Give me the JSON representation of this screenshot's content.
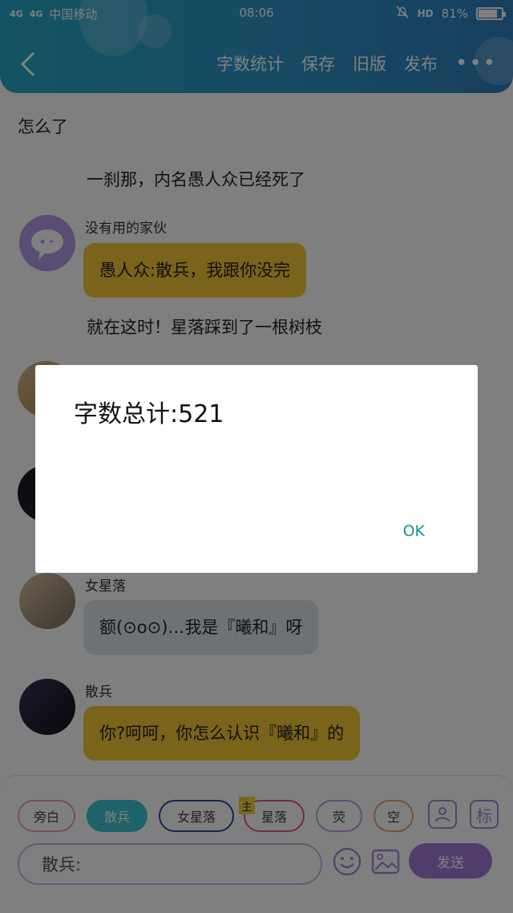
{
  "status": {
    "signal_1": "4G",
    "signal_2": "4G",
    "carrier": "中国移动",
    "time": "08:06",
    "hd": "HD",
    "battery_text": "81%",
    "battery_level": 0.81
  },
  "header": {
    "nav": [
      "字数统计",
      "保存",
      "旧版",
      "发布"
    ],
    "more": "•••"
  },
  "chat": {
    "line_1": "怎么了",
    "line_2": "一刹那，内名愚人众已经死了",
    "msg_1_name": "没有用的家伙",
    "msg_1_text": "愚人众:散兵，我跟你没完",
    "line_3": "就在这时！星落踩到了一根树枝",
    "msg_4_name": "女星落",
    "msg_4_text": "额(⊙o⊙)…我是『曦和』呀",
    "msg_5_name": "散兵",
    "msg_5_text": "你?呵呵，你怎么认识『曦和』的"
  },
  "composer": {
    "chips": [
      "旁白",
      "散兵",
      "女星落",
      "星落",
      "荧",
      "空"
    ],
    "mini_tag": "主",
    "tag_button": "标",
    "input_value": "散兵:",
    "send_label": "发送"
  },
  "dialog": {
    "title": "字数总计:521",
    "ok_label": "OK"
  },
  "colors": {
    "header_from": "#27a7c9",
    "header_to": "#2e7fbd",
    "yellow_bubble": "#f5c634",
    "grey_bubble": "#dfe4eb",
    "accent_purple": "#a07bdc",
    "accent_teal": "#3cc7cf",
    "ok_text": "#15948d"
  }
}
